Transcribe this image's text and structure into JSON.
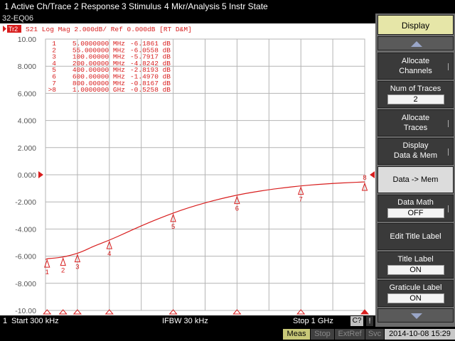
{
  "menu": {
    "items": [
      "1 Active Ch/Trace",
      "2 Response",
      "3 Stimulus",
      "4 Mkr/Analysis",
      "5 Instr State"
    ]
  },
  "window_title": "32-EQ06",
  "trace_header": {
    "tr_badge": "Tr2",
    "text": "S21  Log Mag 2.000dB/ Ref 0.000dB [RT D&M]"
  },
  "marker_table": [
    {
      "num": "1",
      "freq": "5.0000000 MHz",
      "value": "-6.1861 dB"
    },
    {
      "num": "2",
      "freq": "55.000000 MHz",
      "value": "-6.0558 dB"
    },
    {
      "num": "3",
      "freq": "100.00000 MHz",
      "value": "-5.7917 dB"
    },
    {
      "num": "4",
      "freq": "200.00000 MHz",
      "value": "-4.8242 dB"
    },
    {
      "num": "5",
      "freq": "400.00000 MHz",
      "value": "-2.8193 dB"
    },
    {
      "num": "6",
      "freq": "600.00000 MHz",
      "value": "-1.4970 dB"
    },
    {
      "num": "7",
      "freq": "800.00000 MHz",
      "value": "-0.8167 dB"
    },
    {
      "num": ">8",
      "freq": "1.0000000 GHz",
      "value": "-0.5258 dB"
    }
  ],
  "chart_data": {
    "type": "line",
    "title": "",
    "xlabel": "",
    "ylabel": "",
    "xlim": [
      0.0003,
      1000
    ],
    "xunit": "MHz",
    "ylim": [
      -10,
      10
    ],
    "yticks": [
      "10.00",
      "8.000",
      "6.000",
      "4.000",
      "2.000",
      "0.000",
      "-2.000",
      "-4.000",
      "-6.000",
      "-8.000",
      "-10.00"
    ],
    "grid": true,
    "reference_level": 0,
    "trace_color": "#d81e1e",
    "series": [
      {
        "x": [
          0.3,
          5,
          20,
          40,
          55,
          75,
          100,
          125,
          150,
          200,
          250,
          300,
          350,
          400,
          450,
          500,
          550,
          600,
          650,
          700,
          750,
          800,
          850,
          900,
          950,
          1000
        ],
        "values": [
          -6.25,
          -6.186,
          -6.16,
          -6.11,
          -6.056,
          -5.96,
          -5.792,
          -5.56,
          -5.27,
          -4.824,
          -4.3,
          -3.76,
          -3.27,
          -2.819,
          -2.41,
          -2.07,
          -1.76,
          -1.497,
          -1.28,
          -1.1,
          -0.95,
          -0.817,
          -0.72,
          -0.64,
          -0.58,
          -0.526
        ]
      }
    ],
    "markers": [
      {
        "label": "1",
        "x": 5,
        "y": -6.1861
      },
      {
        "label": "2",
        "x": 55,
        "y": -6.0558
      },
      {
        "label": "3",
        "x": 100,
        "y": -5.7917
      },
      {
        "label": "4",
        "x": 200,
        "y": -4.8242
      },
      {
        "label": "5",
        "x": 400,
        "y": -2.8193
      },
      {
        "label": "6",
        "x": 600,
        "y": -1.497
      },
      {
        "label": "7",
        "x": 800,
        "y": -0.8167
      },
      {
        "label": "8",
        "x": 1000,
        "y": -0.5258
      }
    ]
  },
  "status": {
    "channel": "1",
    "start": "Start 300 kHz",
    "ifbw": "IFBW 30 kHz",
    "stop": "Stop 1 GHz",
    "badge": "C?",
    "excl": "!"
  },
  "bottom": {
    "meas": "Meas",
    "stop": "Stop",
    "extref": "ExtRef",
    "svc": "Svc",
    "datetime": "2014-10-08 15:29"
  },
  "softkeys": {
    "header": "Display",
    "allocate_channels": "Allocate Channels",
    "num_traces_label": "Num of Traces",
    "num_traces_value": "2",
    "allocate_traces": "Allocate Traces",
    "display_label": "Display",
    "display_value": "Data & Mem",
    "data_to_mem": "Data -> Mem",
    "data_math_label": "Data Math",
    "data_math_value": "OFF",
    "edit_title_label": "Edit Title Label",
    "title_label_label": "Title Label",
    "title_label_value": "ON",
    "graticule_label_label": "Graticule Label",
    "graticule_label_value": "ON"
  },
  "colors": {
    "trace": "#d81e1e",
    "grid": "#b4b4b4",
    "softkey_header": "#e6e6a8",
    "meas_active": "#c8c878"
  }
}
